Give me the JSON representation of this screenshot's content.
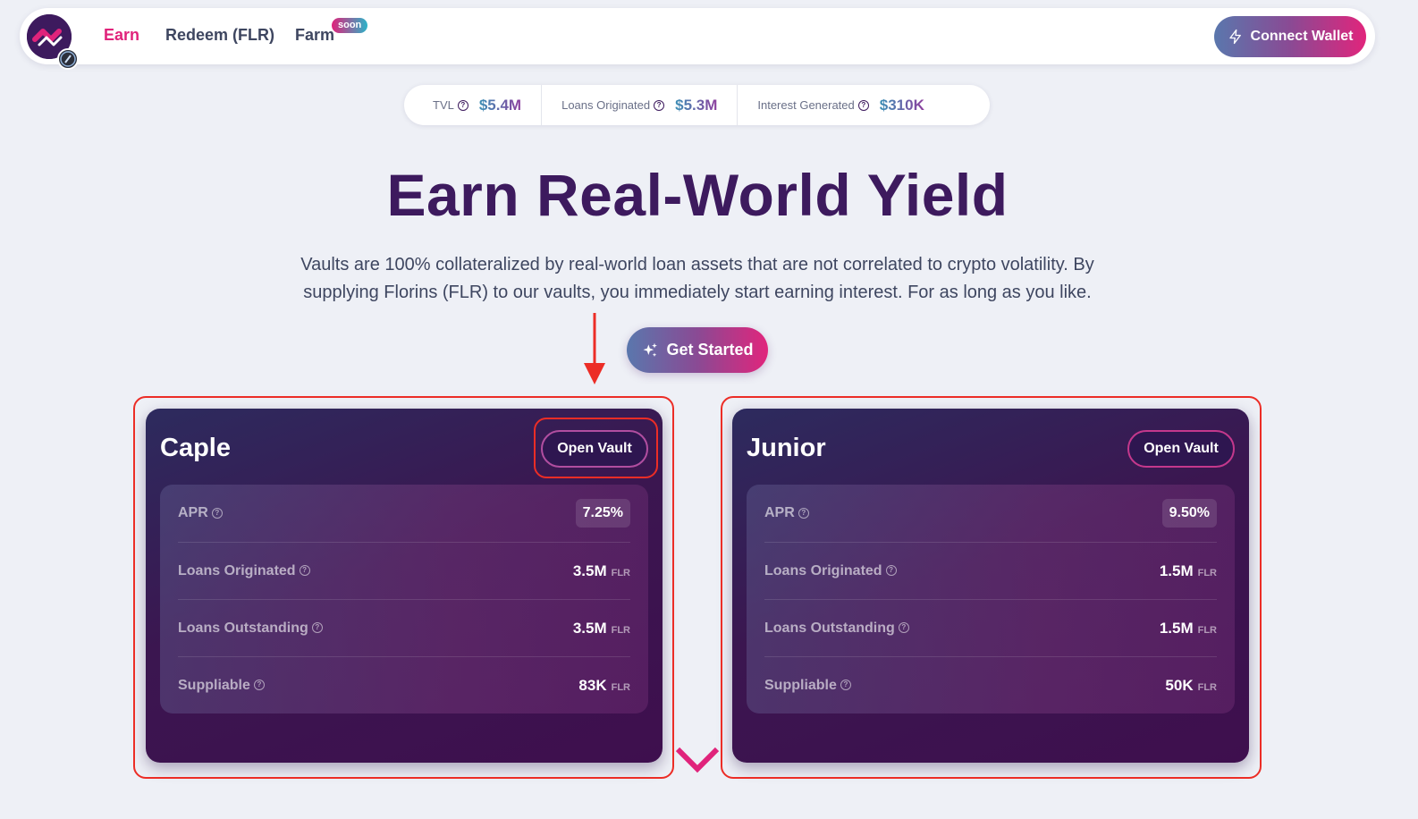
{
  "nav": {
    "links": [
      {
        "label": "Earn",
        "active": true
      },
      {
        "label": "Redeem (FLR)",
        "active": false
      },
      {
        "label": "Farm",
        "active": false
      }
    ],
    "farm_badge": "soon",
    "connect_label": "Connect Wallet",
    "accent_color": "#e0237b"
  },
  "stats": [
    {
      "label": "TVL",
      "value": "$5.4M"
    },
    {
      "label": "Loans Originated",
      "value": "$5.3M"
    },
    {
      "label": "Interest Generated",
      "value": "$310K"
    }
  ],
  "hero": {
    "title": "Earn Real-World Yield",
    "description": "Vaults are 100% collateralized by real-world loan assets that are not correlated to crypto volatility. By supplying Florins (FLR) to our vaults, you immediately start earning interest. For as long as you like.",
    "cta_label": "Get Started"
  },
  "vaults": [
    {
      "name": "Caple",
      "button": "Open Vault",
      "rows": [
        {
          "label": "APR",
          "value": "7.25%",
          "unit": ""
        },
        {
          "label": "Loans Originated",
          "value": "3.5M",
          "unit": "FLR"
        },
        {
          "label": "Loans Outstanding",
          "value": "3.5M",
          "unit": "FLR"
        },
        {
          "label": "Suppliable",
          "value": "83K",
          "unit": "FLR"
        }
      ]
    },
    {
      "name": "Junior",
      "button": "Open Vault",
      "rows": [
        {
          "label": "APR",
          "value": "9.50%",
          "unit": ""
        },
        {
          "label": "Loans Originated",
          "value": "1.5M",
          "unit": "FLR"
        },
        {
          "label": "Loans Outstanding",
          "value": "1.5M",
          "unit": "FLR"
        },
        {
          "label": "Suppliable",
          "value": "50K",
          "unit": "FLR"
        }
      ]
    }
  ],
  "annotation_color": "#ec2d26"
}
